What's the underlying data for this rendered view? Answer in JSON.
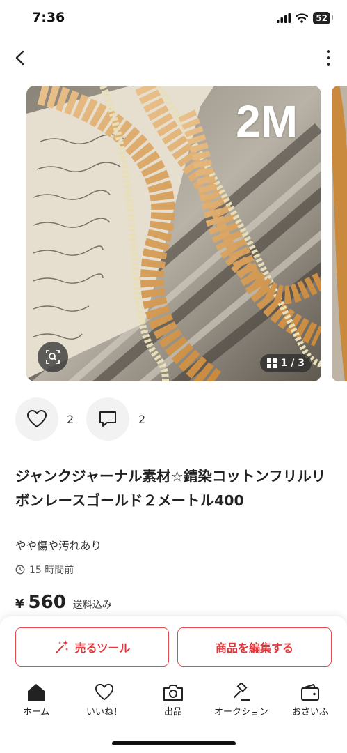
{
  "status_bar": {
    "time": "7:36",
    "battery": "52"
  },
  "item": {
    "photo_label": "2M",
    "photo_counter": "1 / 3",
    "likes": "2",
    "comments": "2",
    "title": "ジャンクジャーナル素材☆錆染コットンフリルリボンレースゴールド２メートル400",
    "condition": "やや傷や汚れあり",
    "posted": "15 時間前",
    "currency": "¥",
    "price": "560",
    "shipping": "送料込み"
  },
  "actions": {
    "sell_tool": "売るツール",
    "edit_item": "商品を編集する"
  },
  "tabs": [
    {
      "label": "ホーム",
      "icon": "home-icon"
    },
    {
      "label": "いいね！",
      "icon": "heart-icon"
    },
    {
      "label": "出品",
      "icon": "camera-icon"
    },
    {
      "label": "オークション",
      "icon": "gavel-icon"
    },
    {
      "label": "おさいふ",
      "icon": "wallet-icon"
    }
  ],
  "colors": {
    "accent": "#e3373c",
    "text": "#222222"
  }
}
